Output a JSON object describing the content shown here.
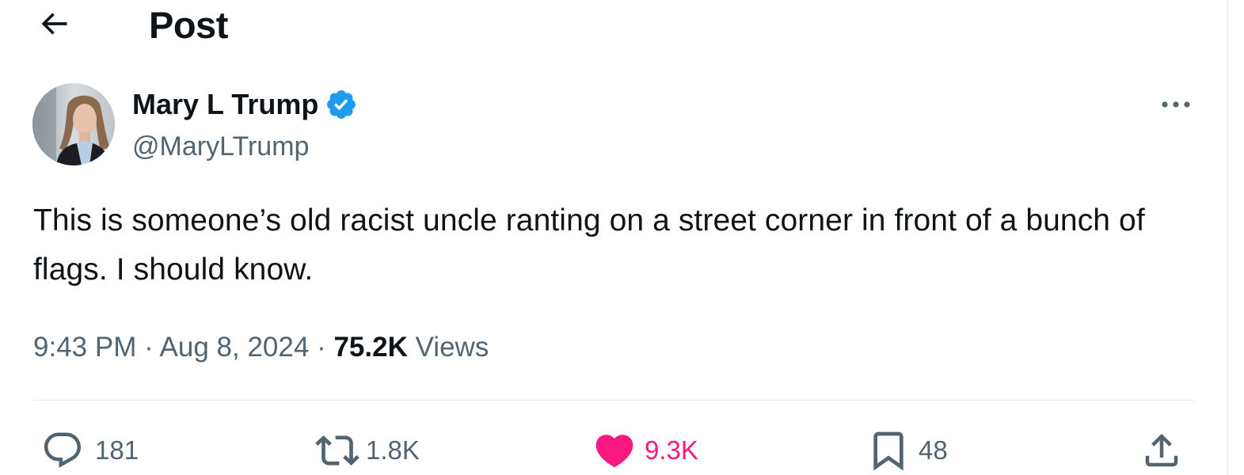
{
  "header": {
    "title": "Post",
    "back_icon": "arrow-left-icon"
  },
  "tweet": {
    "author": {
      "name": "Mary L Trump",
      "handle": "@MaryLTrump",
      "verified": true,
      "verified_color": "#1d9bf0"
    },
    "text": "This is someone’s old racist uncle ranting on a street corner in front of a bunch of flags. I should know.",
    "time": "9:43 PM",
    "date": "Aug 8, 2024",
    "views_count": "75.2K",
    "views_label": "Views",
    "separator": "·"
  },
  "actions": {
    "replies": "181",
    "reposts": "1.8K",
    "likes": "9.3K",
    "bookmarks": "48",
    "liked_color": "#f91880",
    "muted_color": "#536471"
  }
}
